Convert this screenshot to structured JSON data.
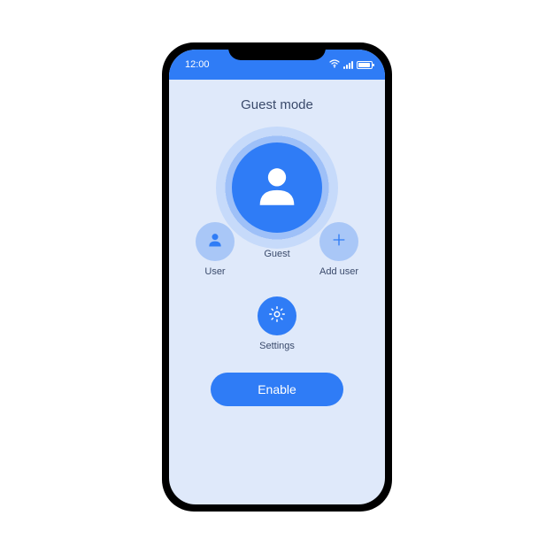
{
  "statusbar": {
    "time": "12:00"
  },
  "page": {
    "title": "Guest mode"
  },
  "profiles": {
    "user": {
      "label": "User"
    },
    "guest": {
      "label": "Guest"
    },
    "add": {
      "label": "Add user"
    }
  },
  "settings": {
    "label": "Settings"
  },
  "actions": {
    "enable_label": "Enable"
  },
  "colors": {
    "accent": "#2f7cf6",
    "background": "#dfe9fa",
    "text": "#3a4a6b",
    "light_circle": "#a9c7f7"
  }
}
